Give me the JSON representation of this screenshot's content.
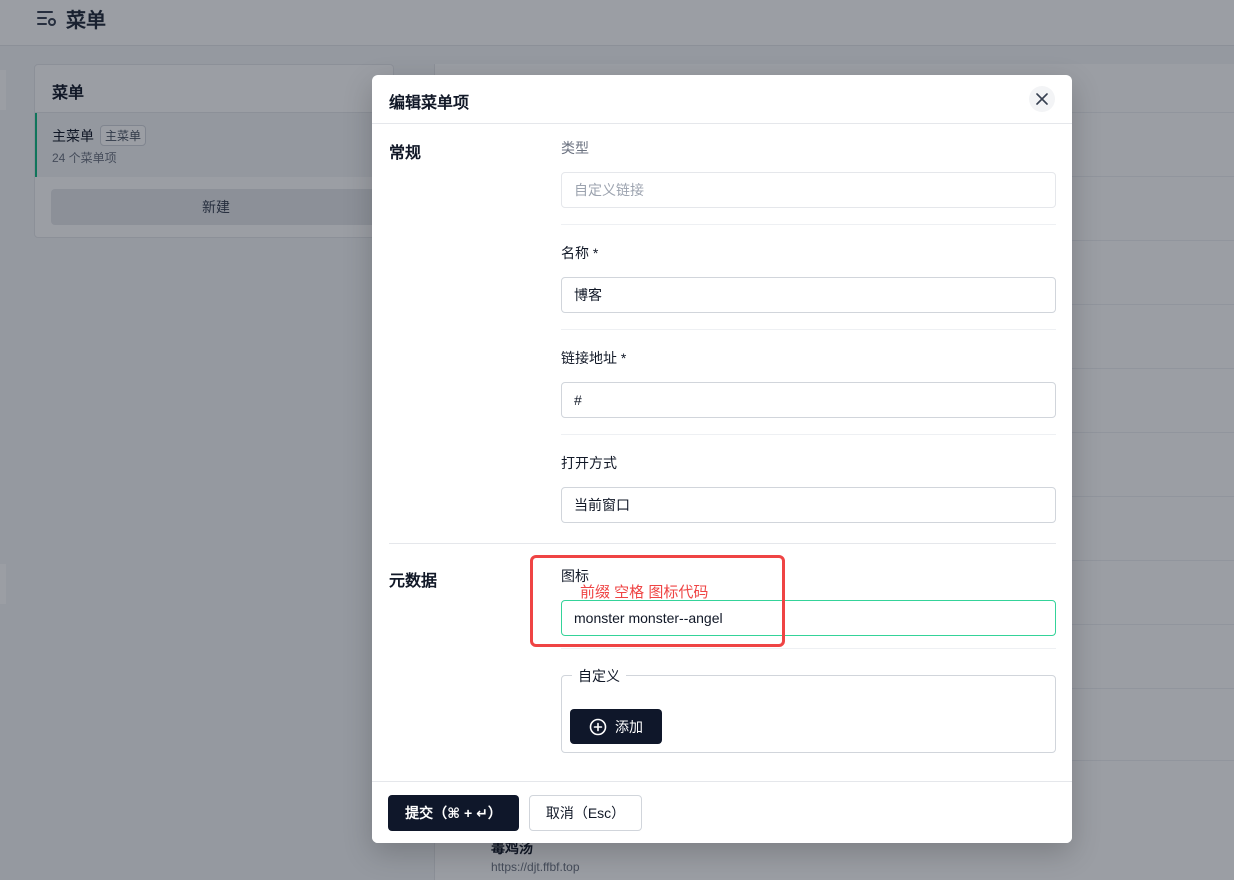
{
  "app": {
    "title": "菜单",
    "icon": "menu-settings-icon"
  },
  "sidebar_card": {
    "title": "菜单",
    "item_name": "主菜单",
    "item_tag": "主菜单",
    "item_count": "24 个菜单项",
    "new_button": "新建"
  },
  "background_list": {
    "row_title": "毒鸡汤",
    "row_url": "https://djt.ffbf.top"
  },
  "modal": {
    "title": "编辑菜单项",
    "close_icon": "close-icon",
    "general_section": "常规",
    "type_label": "类型",
    "type_placeholder": "自定义链接",
    "name_label": "名称 *",
    "name_value": "博客",
    "url_label": "链接地址 *",
    "url_value": "#",
    "open_label": "打开方式",
    "open_value": "当前窗口",
    "meta_section": "元数据",
    "icon_label": "图标",
    "icon_value": "monster monster--angel",
    "annotation": "前缀 空格 图标代码",
    "custom_legend": "自定义",
    "add_button": "添加",
    "add_icon": "plus-circle-icon",
    "submit_button": "提交（⌘ + ↵）",
    "cancel_button": "取消（Esc）"
  },
  "colors": {
    "primary": "#0f172a",
    "focus": "#34d399",
    "annotation": "#ef4444"
  }
}
